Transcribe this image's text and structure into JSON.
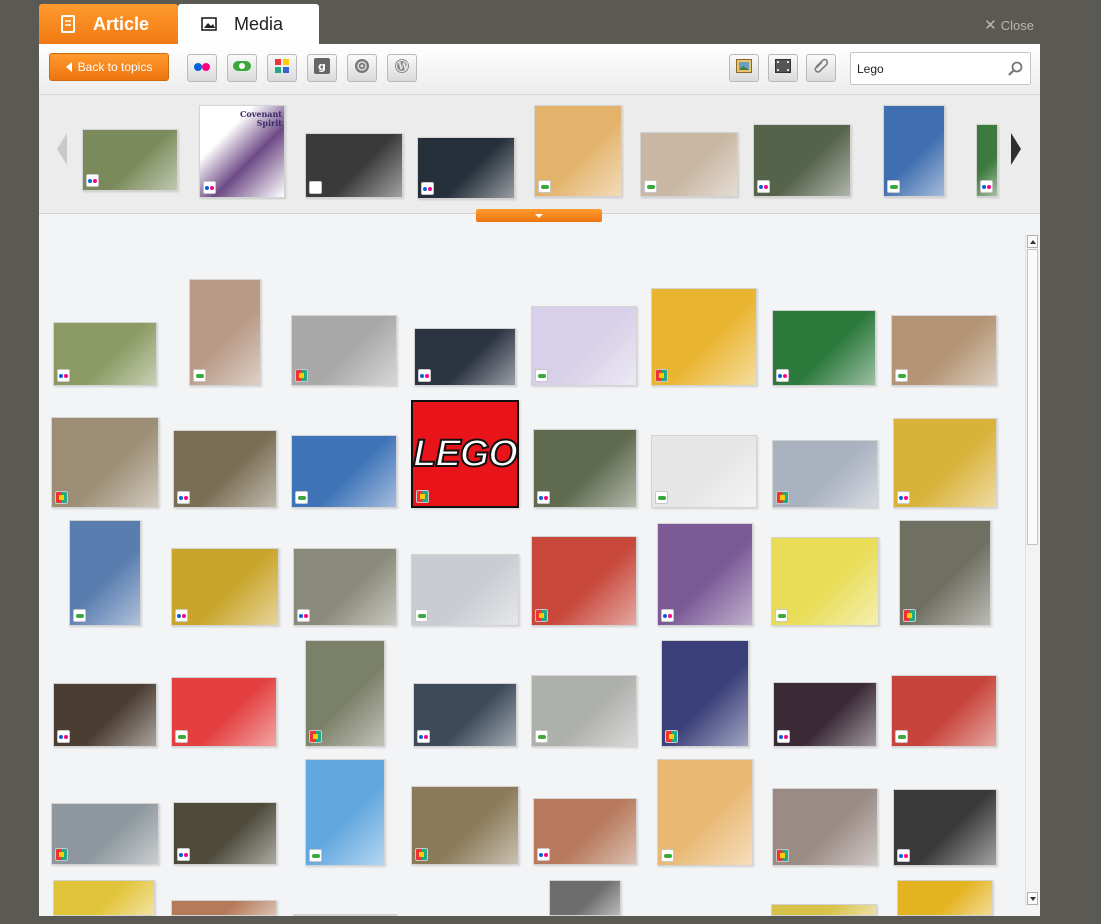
{
  "tabs": [
    {
      "label": "Article",
      "icon": "notebook-icon",
      "active": false
    },
    {
      "label": "Media",
      "icon": "image-icon",
      "active": true
    }
  ],
  "close_label": "Close",
  "toolbar": {
    "back_label": "Back to topics",
    "sources": [
      "flickr-icon",
      "photobucket-icon",
      "picasa-icon",
      "google-icon",
      "spiral-icon",
      "wordpress-icon"
    ],
    "tools": [
      "image-type-icon",
      "video-type-icon",
      "attachment-icon"
    ]
  },
  "search": {
    "value": "Lego",
    "placeholder": ""
  },
  "colors": {
    "accent": "#f07a12",
    "bg": "#5b5953",
    "panel": "#f3f4f6"
  },
  "carousel": [
    {
      "badge": "flickr",
      "color": "#7a8a5a"
    },
    {
      "badge": "flickr",
      "color": "#6e4a86",
      "caption": "Covenant Spirit"
    },
    {
      "badge": "google",
      "color": "#3a3a3a"
    },
    {
      "badge": "flickr",
      "color": "#26303a"
    },
    {
      "badge": "green",
      "color": "#e3b36b"
    },
    {
      "badge": "green",
      "color": "#c9b7a3"
    },
    {
      "badge": "flickr",
      "color": "#56634b"
    },
    {
      "badge": "green",
      "color": "#3f6fb0"
    },
    {
      "badge": "flickr",
      "color": "#3d7a3d"
    }
  ],
  "grid": [
    {
      "badge": "flickr",
      "color": "#8a9a62"
    },
    {
      "badge": "green",
      "color": "#b99a86"
    },
    {
      "badge": "multi",
      "color": "#a9a9a9"
    },
    {
      "badge": "flickr",
      "color": "#2c3442"
    },
    {
      "badge": "green",
      "color": "#d8d0e8"
    },
    {
      "badge": "multi",
      "color": "#e9b531"
    },
    {
      "badge": "flickr",
      "color": "#2d7a3d"
    },
    {
      "badge": "green",
      "color": "#b39474"
    },
    {
      "badge": "multi",
      "color": "#9c8d74"
    },
    {
      "badge": "flickr",
      "color": "#7a6e54"
    },
    {
      "badge": "green",
      "color": "#3e73b8"
    },
    {
      "badge": "multi",
      "logo": "LEGO"
    },
    {
      "badge": "flickr",
      "color": "#5f6a4e"
    },
    {
      "badge": "green",
      "color": "#e6e6e6"
    },
    {
      "badge": "multi",
      "color": "#aab2c0"
    },
    {
      "badge": "flickr",
      "color": "#d9b23a"
    },
    {
      "badge": "green",
      "color": "#5a7db0"
    },
    {
      "badge": "flickr",
      "color": "#c9a52c"
    },
    {
      "badge": "flickr",
      "color": "#8a8a7a"
    },
    {
      "badge": "green",
      "color": "#c9ccd2"
    },
    {
      "badge": "multi",
      "color": "#c7473a"
    },
    {
      "badge": "flickr",
      "color": "#7b5a96"
    },
    {
      "badge": "green",
      "color": "#e9dd58"
    },
    {
      "badge": "multi",
      "color": "#6f6f62"
    },
    {
      "badge": "flickr",
      "color": "#4b3d32"
    },
    {
      "badge": "green",
      "color": "#e44040"
    },
    {
      "badge": "multi",
      "color": "#7b8069"
    },
    {
      "badge": "flickr",
      "color": "#3d4a5a"
    },
    {
      "badge": "green",
      "color": "#aeb0ac"
    },
    {
      "badge": "multi",
      "color": "#3a3f7a"
    },
    {
      "badge": "flickr",
      "color": "#3a2a36"
    },
    {
      "badge": "green",
      "color": "#c7443a"
    },
    {
      "badge": "multi",
      "color": "#8d979d"
    },
    {
      "badge": "flickr",
      "color": "#4d4a3a"
    },
    {
      "badge": "green",
      "color": "#62a8e0"
    },
    {
      "badge": "multi",
      "color": "#8b7a5a"
    },
    {
      "badge": "flickr",
      "color": "#b77a5c"
    },
    {
      "badge": "green",
      "color": "#e9b873"
    },
    {
      "badge": "multi",
      "color": "#9a8b85"
    },
    {
      "badge": "flickr",
      "color": "#3a3a3a"
    },
    {
      "badge": "none",
      "color": "#e2c43a"
    },
    {
      "badge": "none",
      "color": "#b57a5a"
    },
    {
      "badge": "none",
      "color": "#4aa0c0"
    },
    {
      "badge": "none",
      "color": "#6a7a8a"
    },
    {
      "badge": "none",
      "color": "#6d6d6d"
    },
    {
      "badge": "none",
      "color": "#cfb9c5"
    },
    {
      "badge": "none",
      "color": "#d8c24a"
    },
    {
      "badge": "none",
      "color": "#e4b320"
    }
  ]
}
